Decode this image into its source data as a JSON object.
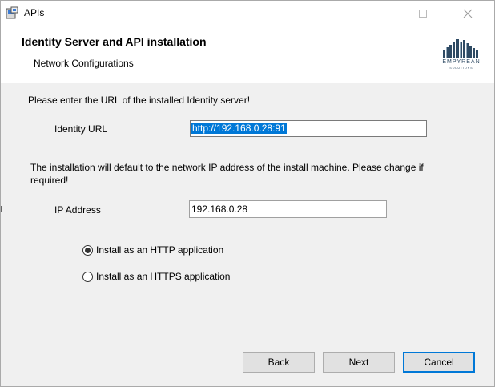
{
  "window": {
    "title": "APIs"
  },
  "header": {
    "title": "Identity Server and API installation",
    "subtitle": "Network Configurations",
    "logo": {
      "name": "EMPYREAN",
      "tagline": "SOLUTIONS"
    }
  },
  "identity": {
    "prompt": "Please enter the URL of the installed Identity server!",
    "label": "Identity URL",
    "value": "http://192.168.0.28:91"
  },
  "network": {
    "prompt": "The installation will default to the network IP address of the install machine. Please change if required!",
    "ip_label": "IP Address",
    "ip_value": "192.168.0.28"
  },
  "radios": {
    "http_label": "Install as an HTTP application",
    "https_label": "Install as an HTTPS application",
    "selected": "http"
  },
  "buttons": {
    "back": "Back",
    "next": "Next",
    "cancel": "Cancel"
  },
  "colors": {
    "selection": "#0078d7",
    "focus_border": "#0078d7",
    "logo": "#2e4a63"
  }
}
